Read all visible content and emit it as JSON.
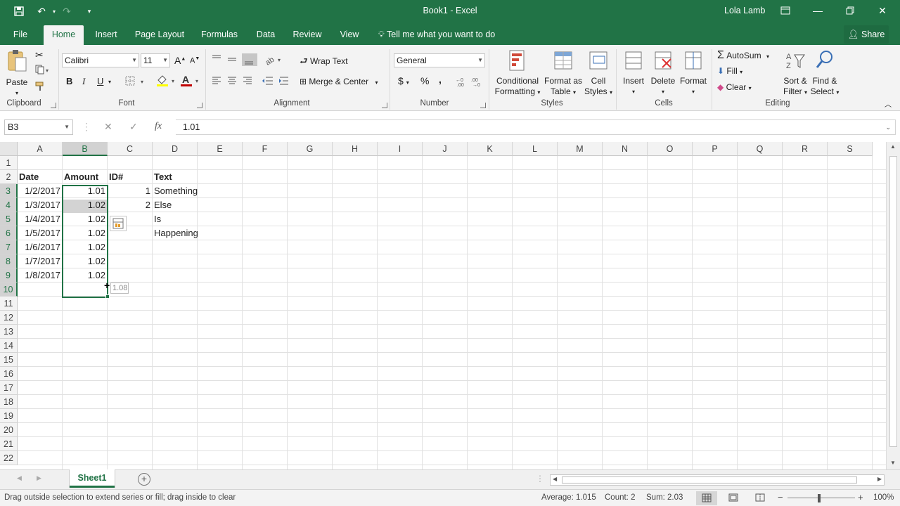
{
  "window": {
    "title": "Book1 - Excel",
    "user": "Lola Lamb"
  },
  "tabs": [
    "File",
    "Home",
    "Insert",
    "Page Layout",
    "Formulas",
    "Data",
    "Review",
    "View"
  ],
  "tell_me": "Tell me what you want to do",
  "share": "Share",
  "ribbon": {
    "clipboard": {
      "paste": "Paste",
      "label": "Clipboard"
    },
    "font": {
      "name": "Calibri",
      "size": "11",
      "bold": "B",
      "italic": "I",
      "underline": "U",
      "label": "Font"
    },
    "alignment": {
      "wrap": "Wrap Text",
      "merge": "Merge & Center",
      "label": "Alignment"
    },
    "number": {
      "format": "General",
      "currency": "$",
      "percent": "%",
      "comma": ",",
      "label": "Number"
    },
    "styles": {
      "conditional_1": "Conditional",
      "conditional_2": "Formatting",
      "format_table_1": "Format as",
      "format_table_2": "Table",
      "cell_styles_1": "Cell",
      "cell_styles_2": "Styles",
      "label": "Styles"
    },
    "cells": {
      "insert": "Insert",
      "delete": "Delete",
      "format": "Format",
      "label": "Cells"
    },
    "editing": {
      "autosum": "AutoSum",
      "fill": "Fill",
      "clear": "Clear",
      "sort_1": "Sort &",
      "sort_2": "Filter",
      "find_1": "Find &",
      "find_2": "Select",
      "label": "Editing"
    }
  },
  "formula_bar": {
    "name_box": "B3",
    "fx": "fx",
    "value": "1.01"
  },
  "grid": {
    "columns": [
      "A",
      "B",
      "C",
      "D",
      "E",
      "F",
      "G",
      "H",
      "I",
      "J",
      "K",
      "L",
      "M",
      "N",
      "O",
      "P",
      "Q",
      "R",
      "S"
    ],
    "rows": [
      "1",
      "2",
      "3",
      "4",
      "5",
      "6",
      "7",
      "8",
      "9",
      "10",
      "11",
      "12",
      "13",
      "14",
      "15",
      "16",
      "17",
      "18",
      "19",
      "20",
      "21",
      "22"
    ],
    "cells": {
      "A2": "Date",
      "B2": "Amount",
      "C2": "ID#",
      "D2": "Text",
      "A3": "1/2/2017",
      "B3": "1.01",
      "C3": "1",
      "D3": "Something",
      "A4": "1/3/2017",
      "B4": "1.02",
      "C4": "2",
      "D4": "Else",
      "A5": "1/4/2017",
      "B5": "1.02",
      "D5": "Is",
      "A6": "1/5/2017",
      "B6": "1.02",
      "D6": "Happening",
      "A7": "1/6/2017",
      "B7": "1.02",
      "A8": "1/7/2017",
      "B8": "1.02",
      "A9": "1/8/2017",
      "B9": "1.02"
    },
    "fill_tooltip": "1.08"
  },
  "sheets": [
    "Sheet1"
  ],
  "status": {
    "message": "Drag outside selection to extend series or fill; drag inside to clear",
    "average": "Average: 1.015",
    "count": "Count: 2",
    "sum": "Sum: 2.03",
    "zoom": "100%"
  },
  "colors": {
    "accent": "#217346"
  }
}
